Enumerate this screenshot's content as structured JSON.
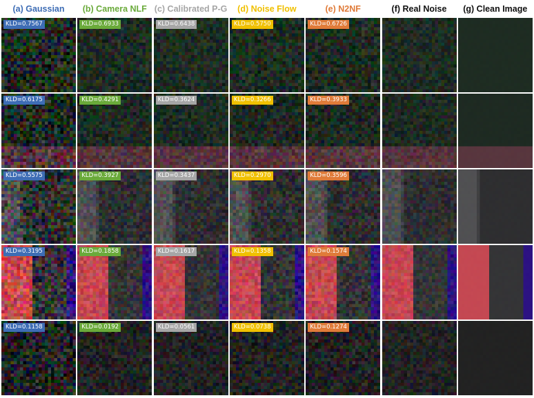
{
  "columns": [
    {
      "id": "gaussian",
      "label": "(a) Gaussian",
      "color": "#3e6db5",
      "noise": 1.0,
      "seed": 11
    },
    {
      "id": "camera-nlf",
      "label": "(b) Camera NLF",
      "color": "#6aaa3a",
      "noise": 0.55,
      "seed": 23
    },
    {
      "id": "calibrated-pg",
      "label": "(c) Calibrated P-G",
      "color": "#a6a6a6",
      "noise": 0.5,
      "seed": 37
    },
    {
      "id": "noise-flow",
      "label": "(d) Noise Flow",
      "color": "#f0c000",
      "noise": 0.6,
      "seed": 41
    },
    {
      "id": "n2nf",
      "label": "(e) N2NF",
      "color": "#e07b39",
      "noise": 0.6,
      "seed": 53
    },
    {
      "id": "real-noise",
      "label": "(f) Real Noise",
      "color": "#111111",
      "noise": 0.45,
      "seed": 67
    },
    {
      "id": "clean-image",
      "label": "(g) Clean Image",
      "color": "#111111",
      "noise": 0.03,
      "seed": 79
    }
  ],
  "rows": [
    {
      "scene": "green",
      "kld": [
        "KLD=0.7567",
        "KLD=0.6933",
        "KLD=0.6438",
        "KLD=0.5750",
        "KLD=0.6726"
      ]
    },
    {
      "scene": "green-pink",
      "kld": [
        "KLD=0.6175",
        "KLD=0.4291",
        "KLD=0.3624",
        "KLD=0.3266",
        "KLD=0.3933"
      ]
    },
    {
      "scene": "gray-stripe",
      "kld": [
        "KLD=0.5575",
        "KLD=0.3927",
        "KLD=0.3437",
        "KLD=0.2970",
        "KLD=0.3596"
      ]
    },
    {
      "scene": "red-gray-purple",
      "kld": [
        "KLD=0.3195",
        "KLD=0.1858",
        "KLD=0.1617",
        "KLD=0.1358",
        "KLD=0.1574"
      ]
    },
    {
      "scene": "dark",
      "kld": [
        "KLD=0.1158",
        "KLD=0.0192",
        "KLD=0.0561",
        "KLD=0.0738",
        "KLD=0.1274"
      ]
    }
  ]
}
